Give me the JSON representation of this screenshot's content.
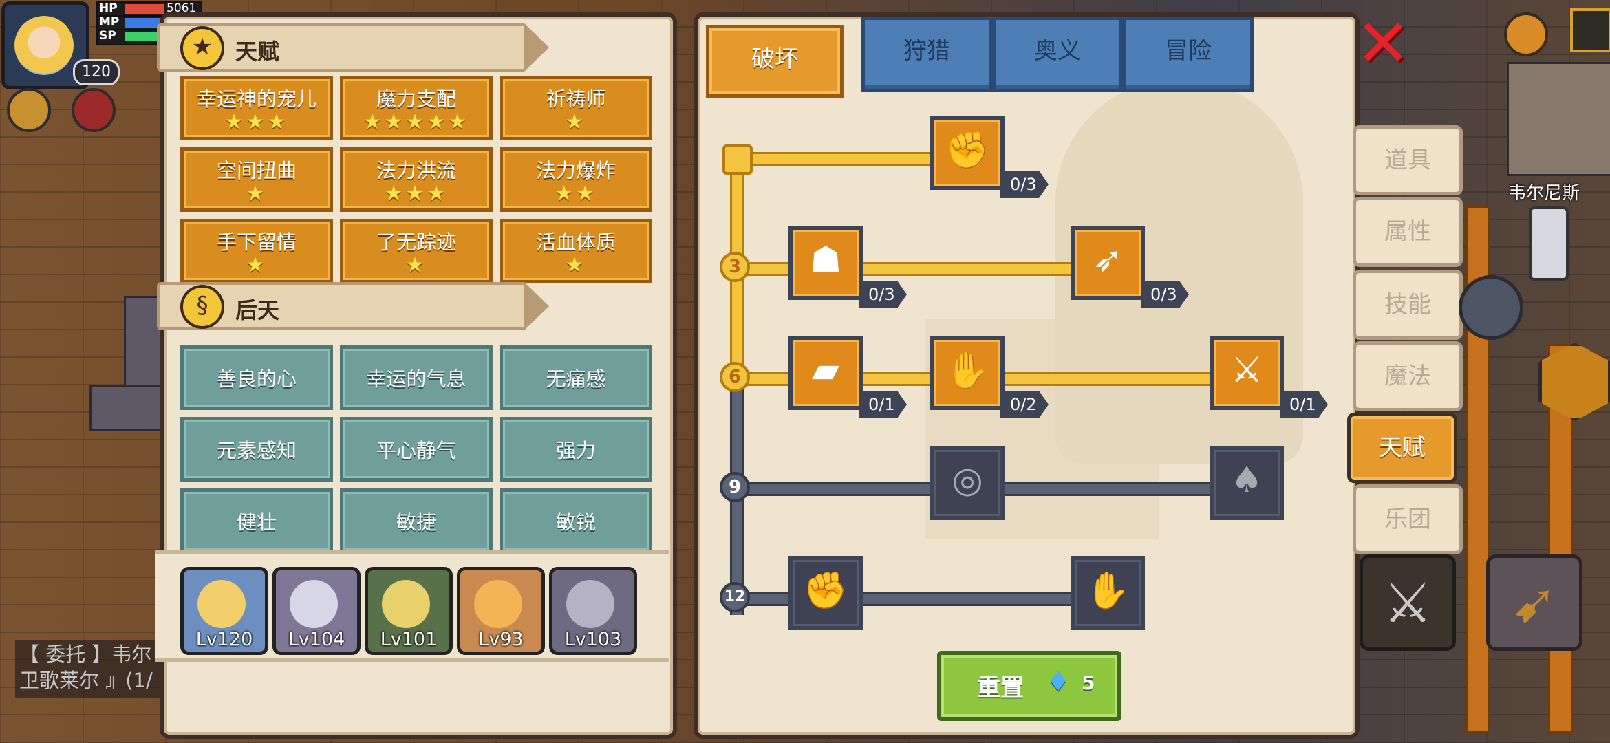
{
  "hud": {
    "level": "120",
    "bars": [
      {
        "label": "HP",
        "value": "5061",
        "color": "#e24a3b"
      },
      {
        "label": "MP",
        "value": "",
        "color": "#3b7be2"
      },
      {
        "label": "SP",
        "value": "",
        "color": "#3bd06a"
      }
    ]
  },
  "left_panel": {
    "innate": {
      "title": "天赋",
      "emblem_icon": "star-icon",
      "items": [
        {
          "name": "幸运神的宠儿",
          "stars": "★★★"
        },
        {
          "name": "魔力支配",
          "stars": "★★★★★"
        },
        {
          "name": "祈祷师",
          "stars": "★"
        },
        {
          "name": "空间扭曲",
          "stars": "★"
        },
        {
          "name": "法力洪流",
          "stars": "★★★"
        },
        {
          "name": "法力爆炸",
          "stars": "★★"
        },
        {
          "name": "手下留情",
          "stars": "★"
        },
        {
          "name": "了无踪迹",
          "stars": "★"
        },
        {
          "name": "活血体质",
          "stars": "★"
        }
      ]
    },
    "acquired": {
      "title": "后天",
      "emblem_icon": "swirl-icon",
      "items": [
        "善良的心",
        "幸运的气息",
        "无痛感",
        "元素感知",
        "平心静气",
        "强力",
        "健壮",
        "敏捷",
        "敏锐"
      ]
    },
    "party": [
      {
        "level": "Lv120"
      },
      {
        "level": "Lv104"
      },
      {
        "level": "Lv101"
      },
      {
        "level": "Lv93"
      },
      {
        "level": "Lv103"
      }
    ]
  },
  "right_panel": {
    "tabs": [
      "破坏",
      "狩猎",
      "奥义",
      "冒险"
    ],
    "active_tab": "破坏",
    "tiers": [
      "3",
      "6",
      "9",
      "12"
    ],
    "skills": [
      {
        "icon": "arm-wrestle-icon",
        "count": "0/3",
        "unlocked": true
      },
      {
        "icon": "muscle-body-icon",
        "count": "0/3",
        "unlocked": true
      },
      {
        "icon": "arrow-pierce-icon",
        "count": "0/3",
        "unlocked": true
      },
      {
        "icon": "card-strike-icon",
        "count": "0/1",
        "unlocked": true
      },
      {
        "icon": "punch-icon",
        "count": "0/2",
        "unlocked": true
      },
      {
        "icon": "slash-burst-icon",
        "count": "0/1",
        "unlocked": true
      },
      {
        "icon": "vortex-icon",
        "count": "",
        "unlocked": false
      },
      {
        "icon": "bat-icon",
        "count": "",
        "unlocked": false
      },
      {
        "icon": "fist-icon",
        "count": "",
        "unlocked": false
      },
      {
        "icon": "gauntlet-icon",
        "count": "",
        "unlocked": false
      }
    ],
    "reset": {
      "label": "重置",
      "cost": "5",
      "icon": "diamond-icon"
    }
  },
  "side_menu": [
    "道具",
    "属性",
    "技能",
    "魔法",
    "天赋",
    "乐团"
  ],
  "side_menu_active": "天赋",
  "map_label": "韦尔尼斯",
  "quest_text": [
    "【 委托 】韦尔",
    "卫歌莱尔 』(1/"
  ],
  "colors": {
    "accent": "#e59a2b",
    "locked": "#3e4252",
    "acquired": "#6f9e9b",
    "confirm": "#8dc63f",
    "close": "#e2232a"
  }
}
